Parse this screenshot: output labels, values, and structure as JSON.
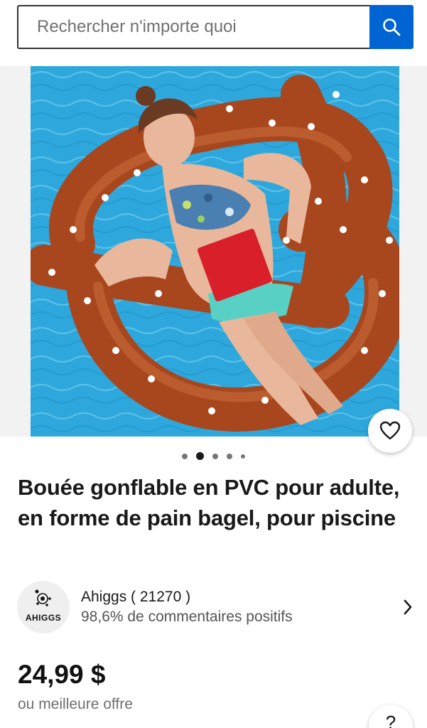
{
  "search": {
    "placeholder": "Rechercher n'importe quoi",
    "icon": "search-icon"
  },
  "gallery": {
    "image_alt": "Bouée gonflable en forme de bretzel dans une piscine",
    "image_count": 5,
    "active_index": 1
  },
  "product": {
    "title": "Bouée gonflable en PVC pour adulte, en forme de pain bagel, pour piscine",
    "price": "24,99 $",
    "offer_text": "ou meilleure offre"
  },
  "seller": {
    "name": "Ahiggs ( 21270 )",
    "feedback": "98,6% de commentaires positifs",
    "logo_text": "AHIGGS"
  },
  "help": {
    "label": "?"
  },
  "colors": {
    "accent": "#0064d2",
    "pool_water": "#2ea8dc",
    "float_brown": "#a8461e"
  }
}
